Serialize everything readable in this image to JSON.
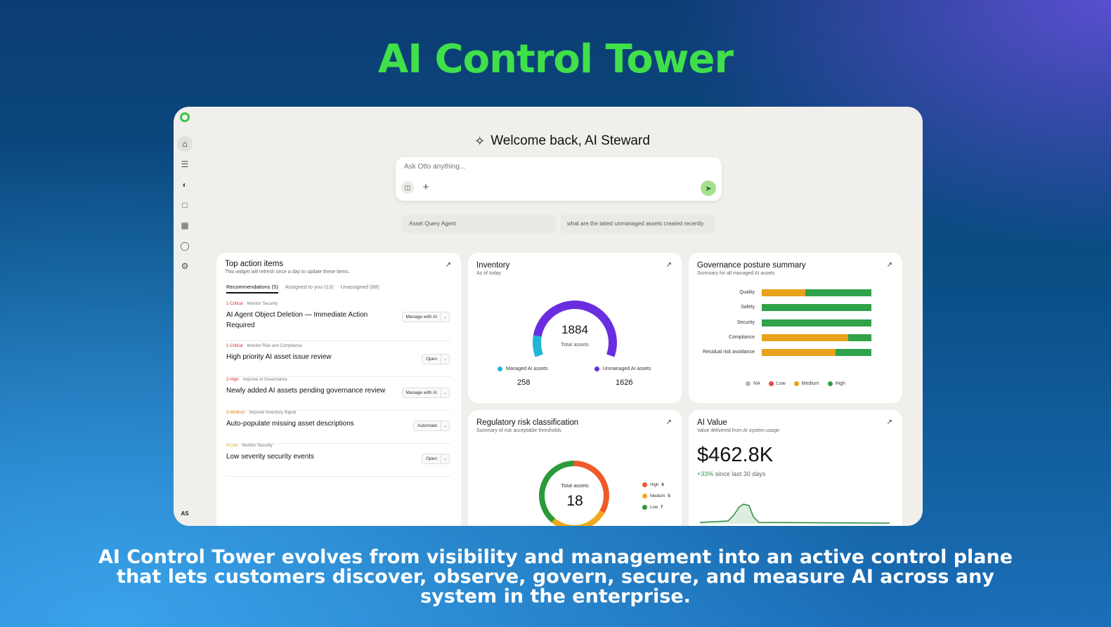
{
  "hero": {
    "title": "AI Control Tower",
    "caption": "AI Control Tower evolves from visibility and management into an active control plane that lets customers discover, observe, govern, secure, and measure AI across any system in the enterprise."
  },
  "rail": {
    "items": [
      "home-icon",
      "filters-icon",
      "dashboard-icon",
      "calendar-icon",
      "building-icon",
      "lightbulb-icon",
      "gear-icon"
    ],
    "avatar": "AS"
  },
  "welcome": {
    "text": "Welcome back, AI Steward"
  },
  "ask": {
    "placeholder": "Ask Otto anything..."
  },
  "chips": [
    "Asset Query Agent",
    "what are the latest unmanaged assets created recently"
  ],
  "action_items": {
    "title": "Top action items",
    "subtitle": "This widget will refresh once a day to update these items.",
    "tabs": [
      "Recommendations (5)",
      "Assigned to you (13)",
      "Unassigned (88)"
    ],
    "items": [
      {
        "priority": "1-Critical",
        "priority_color": "#d92b2b",
        "category": "Monitor Security",
        "title": "AI Agent Object Deletion — Immediate Action Required",
        "button": "Manage with AI"
      },
      {
        "priority": "1-Critical",
        "priority_color": "#d92b2b",
        "category": "Monitor Risk and Compliance",
        "title": "High priority AI asset issue review",
        "button": "Open"
      },
      {
        "priority": "2-High",
        "priority_color": "#d92b2b",
        "category": "Improve AI Governance",
        "title": "Newly added AI assets pending governance review",
        "button": "Manage with AI"
      },
      {
        "priority": "3-Medium",
        "priority_color": "#e5801a",
        "category": "Improve Inventory Signal",
        "title": "Auto-populate missing asset descriptions",
        "button": "Automate"
      },
      {
        "priority": "4-Low",
        "priority_color": "#d9a51a",
        "category": "Monitor Security",
        "title": "Low severity security events",
        "button": "Open"
      }
    ]
  },
  "inventory": {
    "title": "Inventory",
    "subtitle": "As of today",
    "total": "1884",
    "total_label": "Total assets",
    "managed_label": "Managed AI assets",
    "managed_value": "258",
    "managed_count": 258,
    "managed_color": "#1fb5d6",
    "unmanaged_label": "Unmanaged AI assets",
    "unmanaged_value": "1626",
    "unmanaged_count": 1626,
    "unmanaged_color": "#6a2ee0"
  },
  "governance": {
    "title": "Governance posture summary",
    "subtitle": "Summary for all managed AI assets",
    "rows": [
      {
        "label": "Quality",
        "medium": 40,
        "high": 60
      },
      {
        "label": "Safety",
        "medium": 0,
        "high": 100
      },
      {
        "label": "Security",
        "medium": 0,
        "high": 100
      },
      {
        "label": "Compliance",
        "medium": 79,
        "high": 21
      },
      {
        "label": "Residual risk avoidance",
        "medium": 67,
        "high": 33
      }
    ],
    "legend": [
      {
        "label": "NA",
        "color": "#b8b8b8"
      },
      {
        "label": "Low",
        "color": "#e04a4a"
      },
      {
        "label": "Medium",
        "color": "#e8a21c"
      },
      {
        "label": "High",
        "color": "#2fa24a"
      }
    ]
  },
  "regulatory": {
    "title": "Regulatory risk classification",
    "subtitle": "Summary of risk acceptable thresholds",
    "total_label": "Total assets",
    "total": "18",
    "segments": [
      {
        "label": "High",
        "value": "6",
        "count": 6,
        "color": "#f05a2b"
      },
      {
        "label": "Medium",
        "value": "5",
        "count": 5,
        "color": "#f0a81c"
      },
      {
        "label": "Low",
        "value": "7",
        "count": 7,
        "color": "#2a9a3a"
      }
    ]
  },
  "ai_value": {
    "title": "AI Value",
    "subtitle": "Value delivered from AI system usage",
    "amount": "$462.8K",
    "change": "+33%",
    "change_text": "since last 30 days"
  },
  "colors": {
    "accent_green": "#3fe04a",
    "card_bg": "#ffffff",
    "app_bg": "#f1efeb"
  }
}
